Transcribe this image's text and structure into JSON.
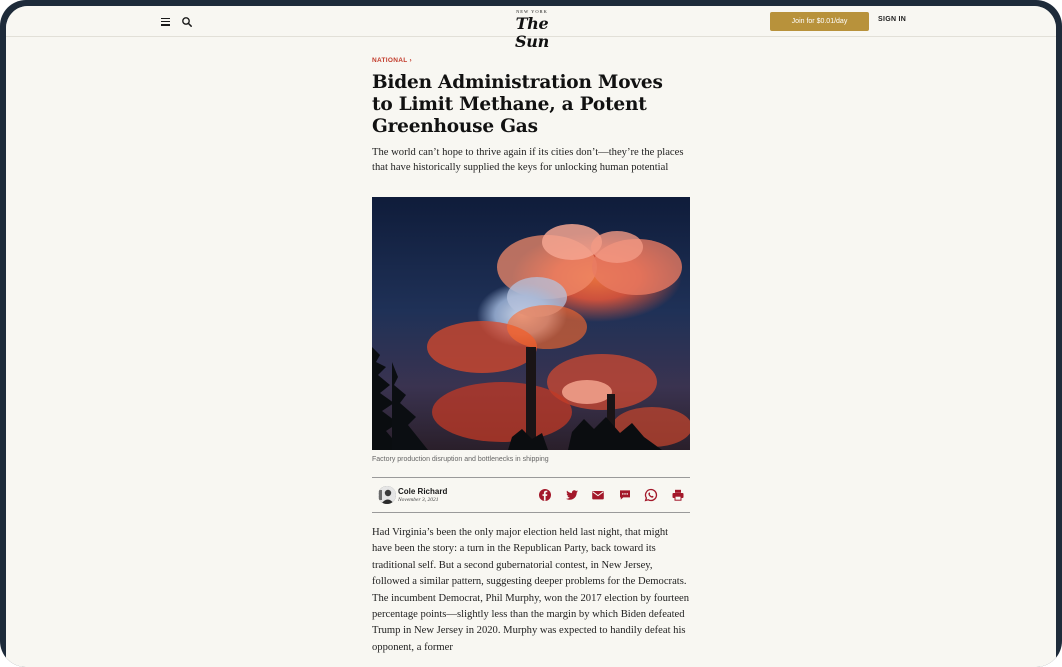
{
  "header": {
    "logo_small": "New York",
    "logo_main": "The Sun",
    "join_label": "Join for $0.01/day",
    "signin_label": "SIGN IN",
    "menu_icon": "hamburger-menu-icon",
    "search_icon": "search-icon"
  },
  "article": {
    "section": "NATIONAL ›",
    "headline": "Biden Administration Moves to Limit Methane, a Potent Greenhouse Gas",
    "dek": "The world can’t hope to thrive again if its cities don’t—they’re the places that have historically supplied the keys for unlocking human potential",
    "image_caption": "Factory production disruption and bottlenecks in shipping",
    "author": {
      "name": "Cole Richard",
      "date": "November 3, 2021"
    },
    "share_icons": [
      "facebook-icon",
      "twitter-icon",
      "email-icon",
      "comment-icon",
      "whatsapp-icon",
      "print-icon"
    ],
    "body": "Had Virginia’s been the only major election held last night, that might have been the story: a turn in the Republican Party, back toward its traditional self. But a second gubernatorial contest, in New Jersey, followed a similar pattern, suggesting deeper problems for the Democrats. The incumbent Democrat, Phil Murphy, won the 2017 election by fourteen percentage points—slightly less than the margin by which Biden defeated Trump in New Jersey in 2020. Murphy was expected to handily defeat his opponent, a former"
  },
  "colors": {
    "accent_gold": "#b8923b",
    "section_red": "#c23b2b",
    "share_icon_red": "#a3182a",
    "page_background": "#f8f7f2",
    "frame": "#1e2b3a"
  }
}
